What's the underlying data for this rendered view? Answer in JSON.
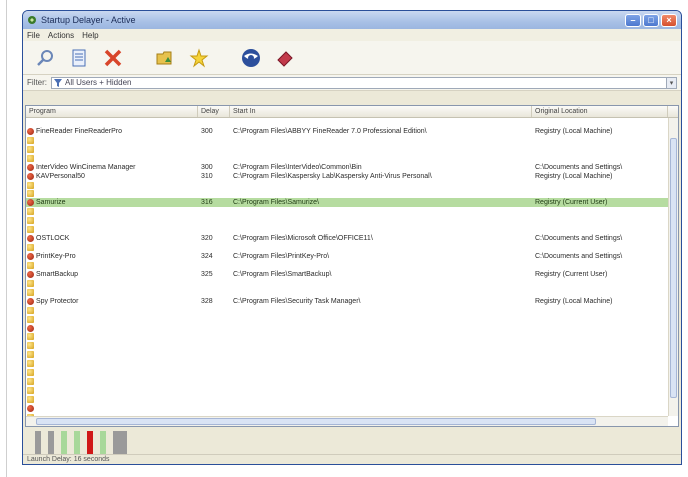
{
  "window": {
    "title": "Startup Delayer - Active"
  },
  "menu": [
    "File",
    "Actions",
    "Help"
  ],
  "toolbar": {
    "icons": [
      "search-icon",
      "properties-icon",
      "delete-icon",
      "folder-icon",
      "star-icon",
      "globe-icon",
      "eraser-icon"
    ]
  },
  "filter": {
    "label": "Filter:",
    "value": "All Users + Hidden"
  },
  "grid": {
    "columns": [
      "Program",
      "Delay",
      "Start In",
      "Original Location"
    ],
    "rows": [
      {
        "icon": "none",
        "program": "",
        "delay": "",
        "start": "",
        "origin": "",
        "state": "dim"
      },
      {
        "icon": "red",
        "program": "FineReader FineReaderPro",
        "delay": "300",
        "start": "C:\\Program Files\\ABBYY FineReader 7.0 Professional Edition\\",
        "origin": "Registry (Local Machine)",
        "state": "active"
      },
      {
        "icon": "yellow",
        "program": "",
        "delay": "",
        "start": "",
        "origin": "",
        "state": "dim"
      },
      {
        "icon": "yellow",
        "program": "",
        "delay": "",
        "start": "",
        "origin": "",
        "state": "dim"
      },
      {
        "icon": "yellow",
        "program": "",
        "delay": "",
        "start": "",
        "origin": "",
        "state": "dim"
      },
      {
        "icon": "red",
        "program": "InterVideo WinCinema Manager",
        "delay": "300",
        "start": "C:\\Program Files\\InterVideo\\Common\\Bin",
        "origin": "C:\\Documents and Settings\\",
        "state": "active"
      },
      {
        "icon": "red",
        "program": "KAVPersonal50",
        "delay": "310",
        "start": "C:\\Program Files\\Kaspersky Lab\\Kaspersky Anti-Virus Personal\\",
        "origin": "Registry (Local Machine)",
        "state": "active"
      },
      {
        "icon": "yellow",
        "program": "",
        "delay": "",
        "start": "",
        "origin": "",
        "state": "dim"
      },
      {
        "icon": "yellow",
        "program": "",
        "delay": "",
        "start": "",
        "origin": "",
        "state": "dim"
      },
      {
        "icon": "red",
        "program": "Samurize",
        "delay": "316",
        "start": "C:\\Program Files\\Samurize\\",
        "origin": "Registry (Current User)",
        "state": "selected"
      },
      {
        "icon": "yellow",
        "program": "",
        "delay": "",
        "start": "",
        "origin": "",
        "state": "dim"
      },
      {
        "icon": "yellow",
        "program": "",
        "delay": "",
        "start": "",
        "origin": "",
        "state": "dim"
      },
      {
        "icon": "yellow",
        "program": "",
        "delay": "",
        "start": "",
        "origin": "",
        "state": "dim"
      },
      {
        "icon": "red",
        "program": "OSTLOCK",
        "delay": "320",
        "start": "C:\\Program Files\\Microsoft Office\\OFFICE11\\",
        "origin": "C:\\Documents and Settings\\",
        "state": "active"
      },
      {
        "icon": "yellow",
        "program": "",
        "delay": "",
        "start": "",
        "origin": "",
        "state": "dim"
      },
      {
        "icon": "red",
        "program": "PrintKey-Pro",
        "delay": "324",
        "start": "C:\\Program Files\\PrintKey-Pro\\",
        "origin": "C:\\Documents and Settings\\",
        "state": "active"
      },
      {
        "icon": "yellow",
        "program": "",
        "delay": "",
        "start": "",
        "origin": "",
        "state": "dim"
      },
      {
        "icon": "red",
        "program": "SmartBackup",
        "delay": "325",
        "start": "C:\\Program Files\\SmartBackup\\",
        "origin": "Registry (Current User)",
        "state": "active"
      },
      {
        "icon": "yellow",
        "program": "",
        "delay": "",
        "start": "",
        "origin": "",
        "state": "dim"
      },
      {
        "icon": "yellow",
        "program": "",
        "delay": "",
        "start": "",
        "origin": "",
        "state": "dim"
      },
      {
        "icon": "red",
        "program": "Spy Protector",
        "delay": "328",
        "start": "C:\\Program Files\\Security Task Manager\\",
        "origin": "Registry (Local Machine)",
        "state": "active"
      },
      {
        "icon": "yellow",
        "program": "",
        "delay": "",
        "start": "",
        "origin": "",
        "state": "dim"
      },
      {
        "icon": "yellow",
        "program": "",
        "delay": "",
        "start": "",
        "origin": "",
        "state": "dim"
      },
      {
        "icon": "red",
        "program": "",
        "delay": "",
        "start": "",
        "origin": "",
        "state": "dim"
      },
      {
        "icon": "yellow",
        "program": "",
        "delay": "",
        "start": "",
        "origin": "",
        "state": "dim"
      },
      {
        "icon": "yellow",
        "program": "",
        "delay": "",
        "start": "",
        "origin": "",
        "state": "dim"
      },
      {
        "icon": "yellow",
        "program": "",
        "delay": "",
        "start": "",
        "origin": "",
        "state": "dim"
      },
      {
        "icon": "yellow",
        "program": "",
        "delay": "",
        "start": "",
        "origin": "",
        "state": "dim"
      },
      {
        "icon": "yellow",
        "program": "",
        "delay": "",
        "start": "",
        "origin": "",
        "state": "dim"
      },
      {
        "icon": "yellow",
        "program": "",
        "delay": "",
        "start": "",
        "origin": "",
        "state": "dim"
      },
      {
        "icon": "yellow",
        "program": "",
        "delay": "",
        "start": "",
        "origin": "",
        "state": "dim"
      },
      {
        "icon": "yellow",
        "program": "",
        "delay": "",
        "start": "",
        "origin": "",
        "state": "dim"
      },
      {
        "icon": "red",
        "program": "",
        "delay": "",
        "start": "",
        "origin": "",
        "state": "dim"
      },
      {
        "icon": "yellow",
        "program": "",
        "delay": "",
        "start": "",
        "origin": "",
        "state": "dim"
      }
    ]
  },
  "timeline": {
    "bar_colors": [
      "#9a9a9a",
      "#9a9a9a",
      "#a8d89a",
      "#a8d89a",
      "#d01818",
      "#a8d89a",
      "#9a9a9a"
    ]
  },
  "status": {
    "text": "Launch Delay: 16 seconds"
  }
}
